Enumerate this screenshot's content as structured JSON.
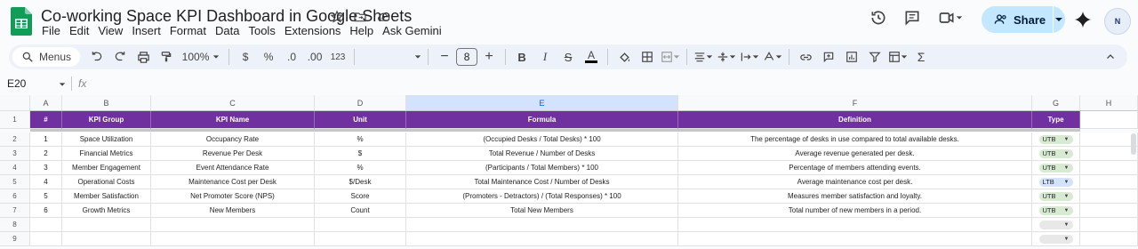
{
  "app": {
    "title": "Co-working Space KPI Dashboard in Google Sheets",
    "menu": [
      "File",
      "Edit",
      "View",
      "Insert",
      "Format",
      "Data",
      "Tools",
      "Extensions",
      "Help",
      "Ask Gemini"
    ],
    "share_label": "Share",
    "avatar_text": "N"
  },
  "toolbar": {
    "menus_label": "Menus",
    "zoom": "100%",
    "currency": "$",
    "percent": "%",
    "dec_decrease": ".0",
    "dec_increase": ".00",
    "number_format": "123",
    "font_size": "8"
  },
  "formula_bar": {
    "cell_ref": "E20",
    "fx_label": "fx",
    "value": ""
  },
  "sheet": {
    "columns": [
      "A",
      "B",
      "C",
      "D",
      "E",
      "F",
      "G",
      "H"
    ],
    "selected_column": "E",
    "header": [
      "#",
      "KPI Group",
      "KPI Name",
      "Unit",
      "Formula",
      "Definition",
      "Type"
    ],
    "rows": [
      {
        "num": "1",
        "group": "Space Utilization",
        "name": "Occupancy Rate",
        "unit": "%",
        "formula": "(Occupied Desks / Total Desks) * 100",
        "definition": "The percentage of desks in use compared to total available desks.",
        "type": "UTB"
      },
      {
        "num": "2",
        "group": "Financial Metrics",
        "name": "Revenue Per Desk",
        "unit": "$",
        "formula": "Total Revenue / Number of Desks",
        "definition": "Average revenue generated per desk.",
        "type": "UTB"
      },
      {
        "num": "3",
        "group": "Member Engagement",
        "name": "Event Attendance Rate",
        "unit": "%",
        "formula": "(Participants / Total Members) * 100",
        "definition": "Percentage of members attending events.",
        "type": "UTB"
      },
      {
        "num": "4",
        "group": "Operational Costs",
        "name": "Maintenance Cost per Desk",
        "unit": "$/Desk",
        "formula": "Total Maintenance Cost / Number of Desks",
        "definition": "Average maintenance cost per desk.",
        "type": "LTB"
      },
      {
        "num": "5",
        "group": "Member Satisfaction",
        "name": "Net Promoter Score (NPS)",
        "unit": "Score",
        "formula": "(Promoters - Detractors) / (Total Responses) * 100",
        "definition": "Measures member satisfaction and loyalty.",
        "type": "UTB"
      },
      {
        "num": "6",
        "group": "Growth Metrics",
        "name": "New Members",
        "unit": "Count",
        "formula": "Total New Members",
        "definition": "Total number of new members in a period.",
        "type": "UTB"
      }
    ],
    "row_numbers": [
      "1",
      "2",
      "3",
      "4",
      "5",
      "6",
      "7",
      "8",
      "9"
    ]
  },
  "colors": {
    "header_bg": "#7030a0",
    "utb_chip": "#d9ead3",
    "ltb_chip": "#d3e3fd",
    "share_bg": "#c2e7ff"
  }
}
